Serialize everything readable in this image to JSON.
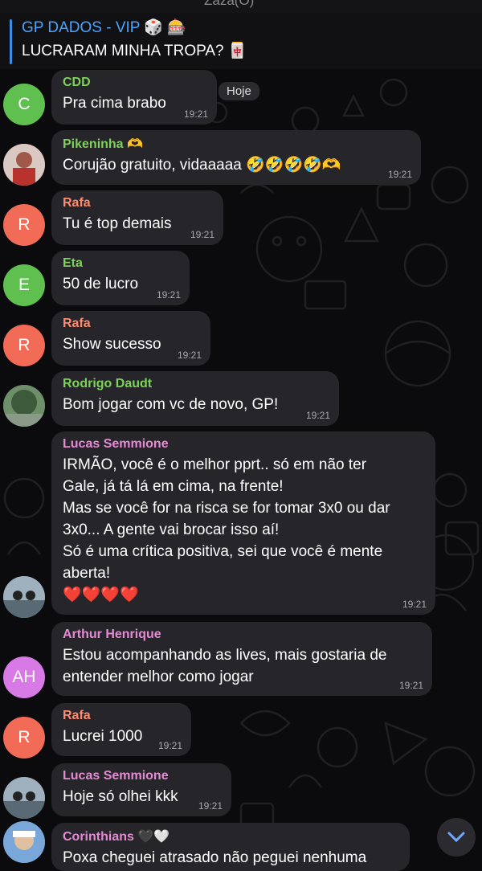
{
  "top_strip": {
    "text": "Zaza(O)"
  },
  "pinned": {
    "title": "GP DADOS - VIP 🎲 🎰",
    "text": "LUCRARAM MINHA TROPA? 🀄"
  },
  "date_chip": "Hoje",
  "messages": [
    {
      "sender": "CDD",
      "sender_color": "#7dd25a",
      "avatar_initials": "C",
      "avatar_color": "#5fbf4f",
      "text": "Pra cima brabo",
      "time": "19:21"
    },
    {
      "sender": "Pikeninha 🫶",
      "sender_color": "#7dd25a",
      "avatar_initials": "",
      "avatar_color": "#b26a5a",
      "text": "Corujão gratuito, vidaaaaa 🤣🤣🤣🤣🫶",
      "time": "19:21"
    },
    {
      "sender": "Rafa",
      "sender_color": "#ff8b70",
      "avatar_initials": "R",
      "avatar_color": "#f26b57",
      "text": "Tu é top demais",
      "time": "19:21"
    },
    {
      "sender": "Eta",
      "sender_color": "#7dd25a",
      "avatar_initials": "E",
      "avatar_color": "#5fbf4f",
      "text": "50 de lucro",
      "time": "19:21"
    },
    {
      "sender": "Rafa",
      "sender_color": "#ff8b70",
      "avatar_initials": "R",
      "avatar_color": "#f26b57",
      "text": "Show sucesso",
      "time": "19:21"
    },
    {
      "sender": "Rodrigo Daudt",
      "sender_color": "#7dd25a",
      "avatar_initials": "",
      "avatar_color": "#4d6b4d",
      "text": "Bom jogar com vc de novo, GP!",
      "time": "19:21"
    },
    {
      "sender": "Lucas Semmione",
      "sender_color": "#e58bd4",
      "avatar_initials": "",
      "avatar_color": "#3a4a5a",
      "text": "IRMÃO, você é o melhor pprt.. só em não ter\nGale, já tá lá em cima, na frente!\nMas se você for na risca se for tomar 3x0 ou dar\n3x0... A gente vai brocar isso aí!\nSó é uma crítica positiva, sei que você é mente\naberta!\n❤️❤️❤️❤️",
      "time": "19:21"
    },
    {
      "sender": "Arthur Henrique",
      "sender_color": "#e58bd4",
      "avatar_initials": "AH",
      "avatar_color": "#d77ae6",
      "text": "Estou acompanhando as lives, mais gostaria de\nentender melhor como jogar",
      "time": "19:21"
    },
    {
      "sender": "Rafa",
      "sender_color": "#ff8b70",
      "avatar_initials": "R",
      "avatar_color": "#f26b57",
      "text": "Lucrei 1000",
      "time": "19:21"
    },
    {
      "sender": "Lucas Semmione",
      "sender_color": "#e58bd4",
      "avatar_initials": "",
      "avatar_color": "#3a4a5a",
      "text": "Hoje só olhei kkk",
      "time": "19:21"
    },
    {
      "sender": "Corinthians 🖤🤍",
      "sender_color": "#e58bd4",
      "avatar_initials": "",
      "avatar_color": "#4a6f9a",
      "text": "Poxa cheguei atrasado não peguei nenhuma",
      "time": ""
    }
  ]
}
